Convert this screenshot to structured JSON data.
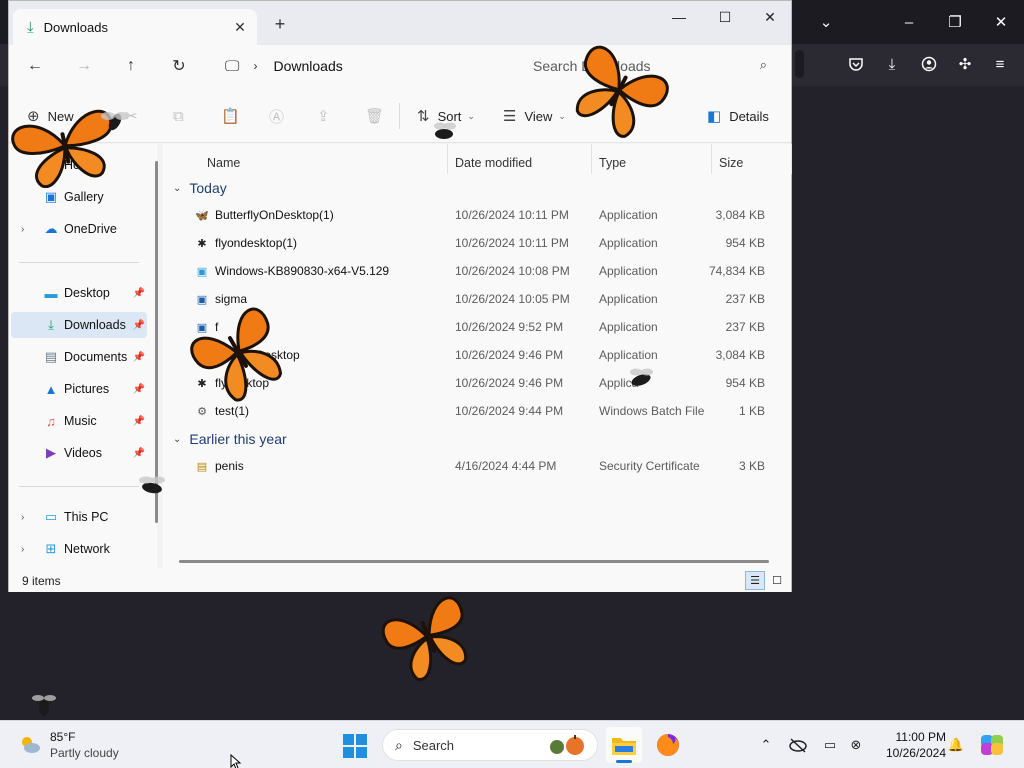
{
  "explorer": {
    "tab_title": "Downloads",
    "address": "Downloads",
    "search_placeholder": "Search Downloads",
    "commands": {
      "new": "New",
      "sort": "Sort",
      "view": "View",
      "details": "Details"
    },
    "sidebar": {
      "quick": [
        "Home",
        "Gallery",
        "OneDrive"
      ],
      "pinned": [
        "Desktop",
        "Downloads",
        "Documents",
        "Pictures",
        "Music",
        "Videos"
      ],
      "bottom": [
        "This PC",
        "Network"
      ],
      "selected": "Downloads"
    },
    "columns": [
      "Name",
      "Date modified",
      "Type",
      "Size"
    ],
    "groups": [
      {
        "label": "Today",
        "files": [
          {
            "name": "ButterflyOnDesktop(1)",
            "date": "10/26/2024 10:11 PM",
            "type": "Application",
            "size": "3,084 KB",
            "icon": "butterfly-icon"
          },
          {
            "name": "flyondesktop(1)",
            "date": "10/26/2024 10:11 PM",
            "type": "Application",
            "size": "954 KB",
            "icon": "fly-icon"
          },
          {
            "name": "Windows-KB890830-x64-V5.129",
            "date": "10/26/2024 10:08 PM",
            "type": "Application",
            "size": "74,834 KB",
            "icon": "installer-icon"
          },
          {
            "name": "sigma",
            "date": "10/26/2024 10:05 PM",
            "type": "Application",
            "size": "237 KB",
            "icon": "app-window-icon"
          },
          {
            "name": "f",
            "date": "10/26/2024 9:52 PM",
            "type": "Application",
            "size": "237 KB",
            "icon": "app-window-icon"
          },
          {
            "name": "lyOnDesktop",
            "date": "10/26/2024 9:46 PM",
            "type": "Application",
            "size": "3,084 KB",
            "icon": "butterfly-icon"
          },
          {
            "name": "flyo  sktop",
            "date": "10/26/2024 9:46 PM",
            "type": "Applica",
            "size": "954 KB",
            "icon": "fly-icon"
          },
          {
            "name": "test(1)",
            "date": "10/26/2024 9:44 PM",
            "type": "Windows Batch File",
            "size": "1 KB",
            "icon": "batch-file-icon"
          }
        ]
      },
      {
        "label": "Earlier this year",
        "files": [
          {
            "name": "penis",
            "date": "4/16/2024 4:44 PM",
            "type": "Security Certificate",
            "size": "3 KB",
            "icon": "certificate-icon"
          }
        ]
      }
    ],
    "status": "9 items"
  },
  "taskbar": {
    "weather_temp": "85°F",
    "weather_cond": "Partly cloudy",
    "search_label": "Search",
    "time": "11:00 PM",
    "date": "10/26/2024"
  },
  "colors": {
    "accent": "#1976d2",
    "butterfly_orange": "#f07a14",
    "selection": "#dbe7f5"
  }
}
